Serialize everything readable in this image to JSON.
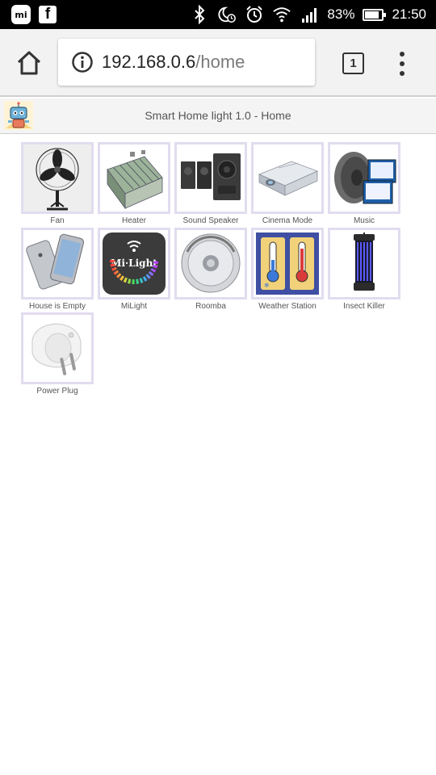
{
  "status_bar": {
    "battery_percent": "83%",
    "battery_level": 0.83,
    "time": "21:50",
    "icons": [
      "mi-app-icon",
      "facebook-icon",
      "bluetooth-icon",
      "do-not-disturb-icon",
      "alarm-icon",
      "wifi-icon",
      "signal-icon",
      "battery-icon"
    ]
  },
  "browser": {
    "url_host": "192.168.0.6",
    "url_path": "/home",
    "tab_count": "1",
    "icons": [
      "home-icon",
      "info-icon",
      "tab-switcher-icon",
      "overflow-menu-icon"
    ]
  },
  "page": {
    "title": "Smart Home light 1.0 - Home"
  },
  "devices": [
    {
      "label": "Fan",
      "icon": "fan-icon"
    },
    {
      "label": "Heater",
      "icon": "heater-icon"
    },
    {
      "label": "Sound Speaker",
      "icon": "speaker-icon"
    },
    {
      "label": "Cinema Mode",
      "icon": "projector-icon"
    },
    {
      "label": "Music",
      "icon": "music-speaker-icon"
    },
    {
      "label": "House is Empty",
      "icon": "phone-icon"
    },
    {
      "label": "MiLight",
      "icon": "milight-icon",
      "image_text": "Mi·Light"
    },
    {
      "label": "Roomba",
      "icon": "roomba-icon"
    },
    {
      "label": "Weather Station",
      "icon": "thermometer-icon"
    },
    {
      "label": "Insect Killer",
      "icon": "insect-killer-icon"
    },
    {
      "label": "Power Plug",
      "icon": "power-plug-icon"
    }
  ]
}
